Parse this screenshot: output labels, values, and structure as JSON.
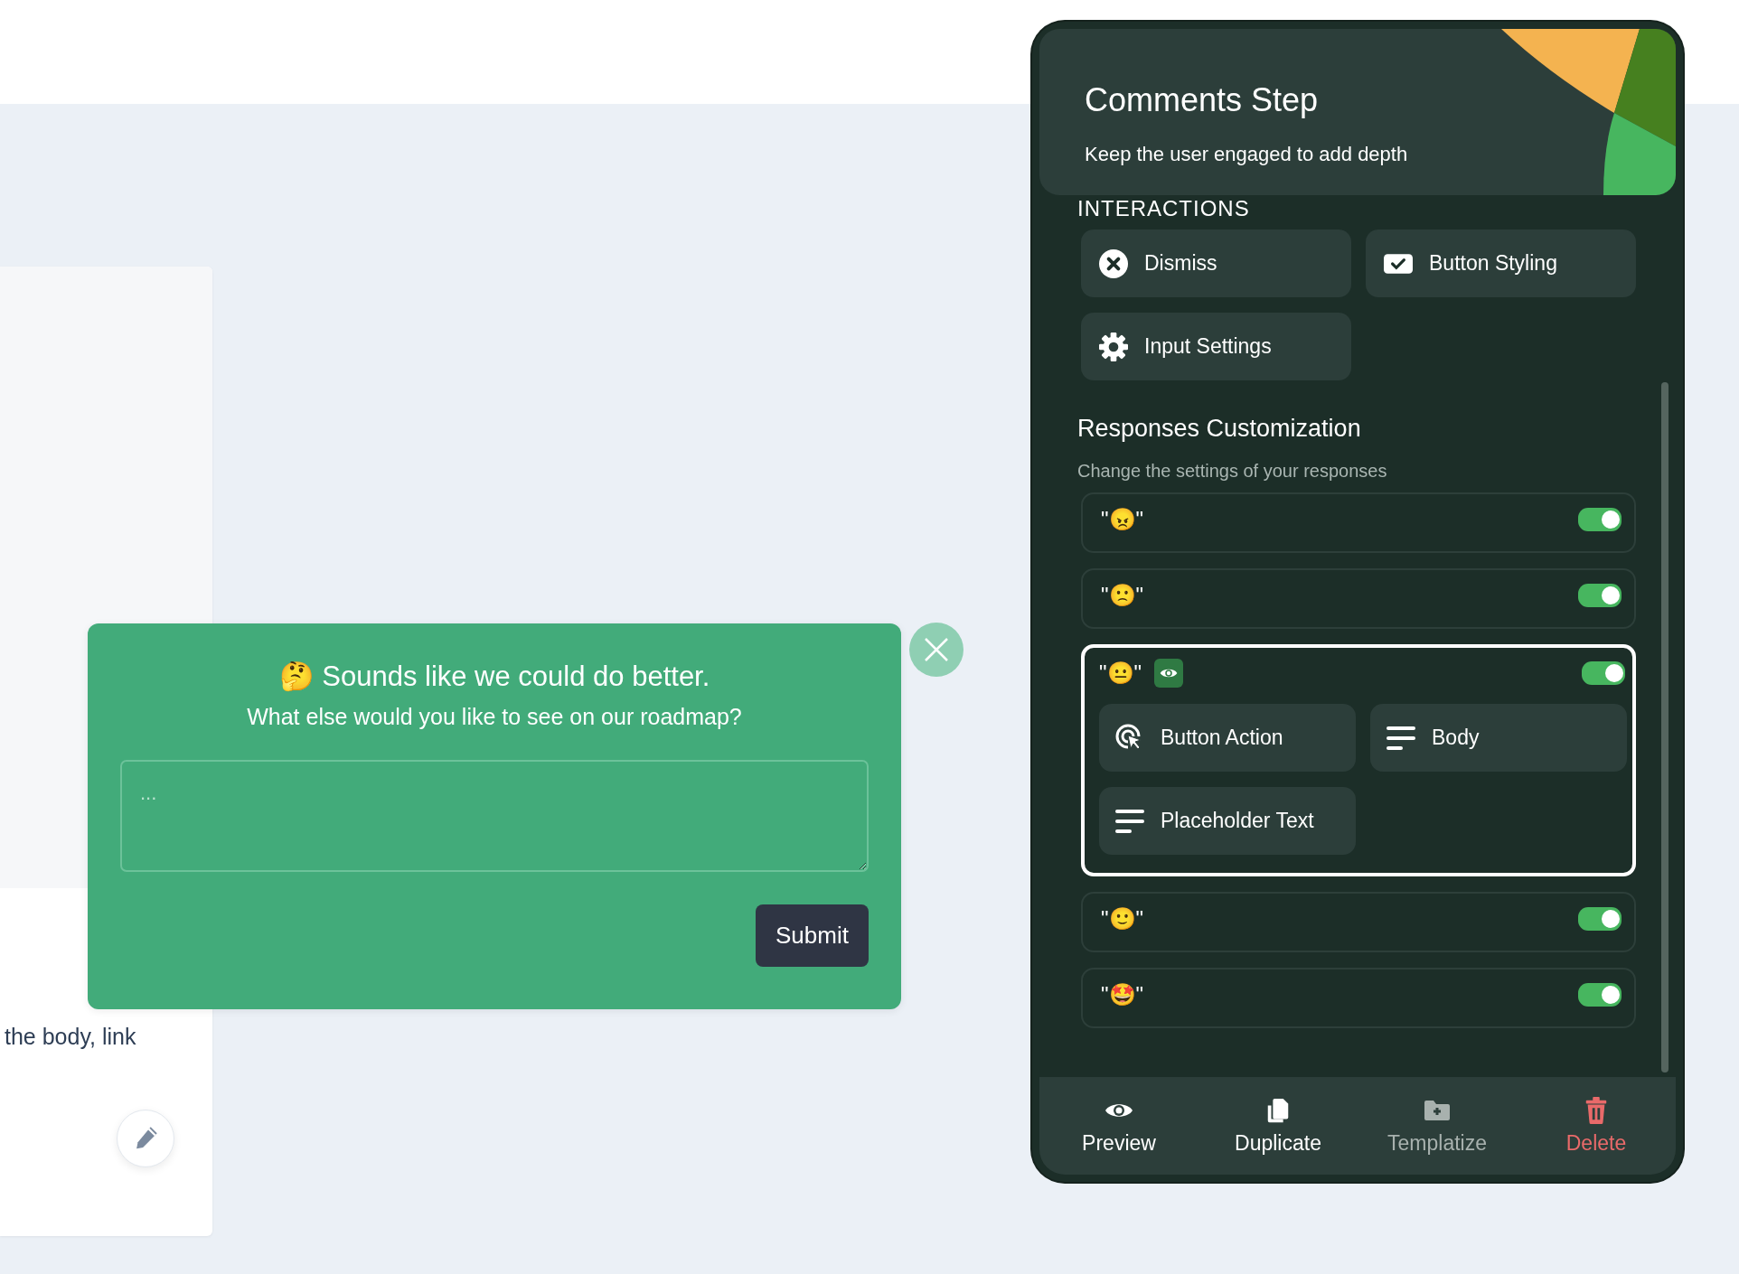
{
  "page": {
    "body_fragment": "the body, link"
  },
  "popup": {
    "title": "🤔 Sounds like we could do better.",
    "subtitle": "What else would you like to see on our roadmap?",
    "comment_field": {
      "placeholder": "..."
    },
    "submit": "Submit"
  },
  "panel": {
    "title": "Comments Step",
    "subtitle": "Keep the user engaged to add depth",
    "section_label": "INTERACTIONS",
    "interactions": [
      {
        "label": "Dismiss",
        "kind": "dismiss"
      },
      {
        "label": "Button Styling",
        "kind": "styling"
      },
      {
        "label": "Input Settings",
        "kind": "settings"
      }
    ],
    "responses": {
      "title": "Responses Customization",
      "subtitle": "Change the settings of your responses",
      "items": [
        {
          "label": "\"😠\"",
          "on": true,
          "expanded": false
        },
        {
          "label": "\"🙁\"",
          "on": true,
          "expanded": false
        },
        {
          "label": "\"😐\"",
          "on": true,
          "expanded": true,
          "options": [
            {
              "label": "Button Action",
              "kind": "action"
            },
            {
              "label": "Body",
              "kind": "text"
            },
            {
              "label": "Placeholder Text",
              "kind": "text"
            }
          ]
        },
        {
          "label": "\"🙂\"",
          "on": true,
          "expanded": false
        },
        {
          "label": "\"🤩\"",
          "on": true,
          "expanded": false
        }
      ]
    },
    "footer": [
      {
        "label": "Preview",
        "kind": "preview",
        "disabled": false
      },
      {
        "label": "Duplicate",
        "kind": "duplicate",
        "disabled": false
      },
      {
        "label": "Templatize",
        "kind": "templatize",
        "disabled": true
      },
      {
        "label": "Delete",
        "kind": "delete",
        "disabled": false
      }
    ]
  }
}
